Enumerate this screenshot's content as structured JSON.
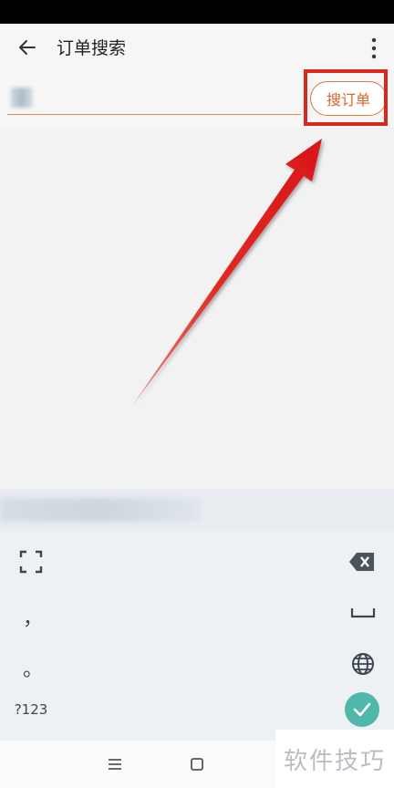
{
  "app_bar": {
    "title": "订单搜索"
  },
  "search": {
    "input_value": "",
    "button_label": "搜订单"
  },
  "keyboard": {
    "comma": "，",
    "period": "。",
    "symbols_label": "?123"
  },
  "watermark": {
    "text": "软件技巧"
  },
  "colors": {
    "accent": "#d8662a",
    "highlight": "#d9281d",
    "confirm": "#4fb8ab"
  },
  "icons": {
    "back": "back-arrow-icon",
    "more": "more-vert-icon",
    "fullscreen": "fullscreen-icon",
    "backspace": "backspace-icon",
    "space": "space-icon",
    "globe": "globe-icon",
    "confirm": "check-icon"
  }
}
